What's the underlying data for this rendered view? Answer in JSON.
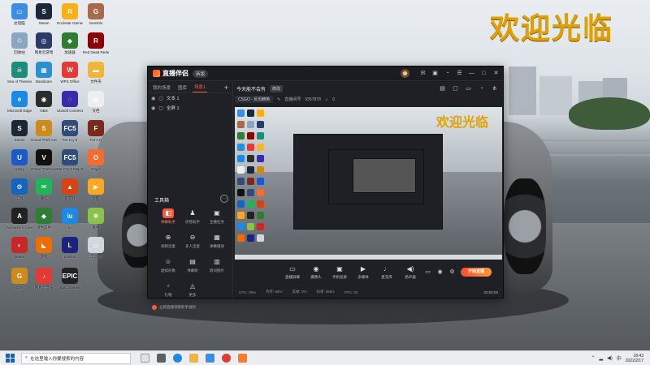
{
  "desktop": {
    "welcome_text": "欢迎光临",
    "icons": [
      {
        "label": "此电脑",
        "color": "#3a8ee6",
        "glyph": "▭"
      },
      {
        "label": "Steam",
        "color": "#1b2838",
        "glyph": "S"
      },
      {
        "label": "Rockstar Games...",
        "color": "#fcaf17",
        "glyph": "R"
      },
      {
        "label": "Genshin",
        "color": "#a86a4a",
        "glyph": "G"
      },
      {
        "label": "回收站",
        "color": "#8aa6c1",
        "glyph": "♲"
      },
      {
        "label": "网易云游戏",
        "color": "#2a3b6a",
        "glyph": "◎"
      },
      {
        "label": "加速器",
        "color": "#2e7d32",
        "glyph": "◆"
      },
      {
        "label": "Red Dead Redemption",
        "color": "#8b0000",
        "glyph": "R"
      },
      {
        "label": "Sea of Thieves",
        "color": "#1e8c7a",
        "glyph": "☠"
      },
      {
        "label": "Bandicam",
        "color": "#2b8fd0",
        "glyph": "▦"
      },
      {
        "label": "WPS Office",
        "color": "#e53935",
        "glyph": "W"
      },
      {
        "label": "文件夹",
        "color": "#f2b53c",
        "glyph": "▬"
      },
      {
        "label": "Microsoft Edge",
        "color": "#1a8ae2",
        "glyph": "e"
      },
      {
        "label": "OBS",
        "color": "#2c2c2c",
        "glyph": "◉"
      },
      {
        "label": "Ubisoft Connect",
        "color": "#3b2ba8",
        "glyph": "◌"
      },
      {
        "label": "文档",
        "color": "#eeeeee",
        "glyph": "▤"
      },
      {
        "label": "Steam",
        "color": "#1b2838",
        "glyph": "S"
      },
      {
        "label": "Grand Theft Auto V",
        "color": "#ce8a1d",
        "glyph": "5"
      },
      {
        "label": "Far Cry 5",
        "color": "#314b7a",
        "glyph": "FC5"
      },
      {
        "label": "Far Cry",
        "color": "#7a2a1a",
        "glyph": "F"
      },
      {
        "label": "Uplay",
        "color": "#1a5ac9",
        "glyph": "U"
      },
      {
        "label": "Grand Theft Auto V",
        "color": "#111111",
        "glyph": "V"
      },
      {
        "label": "Far Cry 5 Map Editor",
        "color": "#314b7a",
        "glyph": "FC5"
      },
      {
        "label": "Origin",
        "color": "#f56c2d",
        "glyph": "O"
      },
      {
        "label": "工具",
        "color": "#1565c0",
        "glyph": "⚙"
      },
      {
        "label": "微信",
        "color": "#20b45a",
        "glyph": "✉"
      },
      {
        "label": "新游戏",
        "color": "#d84315",
        "glyph": "▲"
      },
      {
        "label": "优酷",
        "color": "#f9a825",
        "glyph": "▶"
      },
      {
        "label": "Assassin's Creed",
        "color": "#222222",
        "glyph": "A"
      },
      {
        "label": "绿色软件",
        "color": "#2e7d32",
        "glyph": "◆"
      },
      {
        "label": "iu",
        "color": "#1e88e5",
        "glyph": "iu"
      },
      {
        "label": "素材",
        "color": "#8bc34a",
        "glyph": "❋"
      },
      {
        "label": "steam",
        "color": "#c62828",
        "glyph": "◐"
      },
      {
        "label": "游戏",
        "color": "#ef6c00",
        "glyph": "◣"
      },
      {
        "label": "Lumion",
        "color": "#1a237e",
        "glyph": "L"
      },
      {
        "label": "工具箱",
        "color": "#cfd8dc",
        "glyph": "▭"
      },
      {
        "label": "GTA",
        "color": "#ce8a1d",
        "glyph": "G"
      },
      {
        "label": "网易云音乐",
        "color": "#e53935",
        "glyph": "♪"
      },
      {
        "label": "Epic Games",
        "color": "#222222",
        "glyph": "EPIC"
      }
    ]
  },
  "window": {
    "app_name": "直播伴侣",
    "edition": "新版",
    "left_tabs": [
      "我的场景",
      "图库",
      "场景1"
    ],
    "sources": [
      "文本 1",
      "全屏 1"
    ],
    "toolbox_title": "工具箱",
    "toolbox_more": "···",
    "tools": [
      {
        "label": "弹幕助手",
        "glyph": "◧",
        "hot": true
      },
      {
        "label": "房管助手",
        "glyph": "♟",
        "hot": false
      },
      {
        "label": "主播任务",
        "glyph": "▣",
        "hot": false
      },
      {
        "label": "视频连麦",
        "glyph": "⊕",
        "hot": false
      },
      {
        "label": "多人连麦",
        "glyph": "⊖",
        "hot": false
      },
      {
        "label": "弹幕播放",
        "glyph": "▦",
        "hot": false
      },
      {
        "label": "虚拟形象",
        "glyph": "☺",
        "hot": false
      },
      {
        "label": "弹幕姬",
        "glyph": "▤",
        "hot": false
      },
      {
        "label": "歌词图片",
        "glyph": "▥",
        "hot": false
      },
      {
        "label": "礼物",
        "glyph": "▫",
        "hot": false
      },
      {
        "label": "更多",
        "glyph": "◬",
        "hot": false
      }
    ],
    "ad_text": "立即直播领取新手福利",
    "stream_title": "今天能不会有",
    "edit_button": "修改",
    "game_select": "CSGO - 反恐精英",
    "room_label": "直播间号",
    "room_id": "9357878",
    "preview_welcome": "欢迎光临",
    "bottom_items": [
      {
        "label": "直播屏幕",
        "glyph": "▭"
      },
      {
        "label": "摄像头",
        "glyph": "◉"
      },
      {
        "label": "手机投屏",
        "glyph": "▣"
      },
      {
        "label": "多媒体",
        "glyph": "▶"
      },
      {
        "label": "麦克风",
        "glyph": "♩"
      },
      {
        "label": "扬声器",
        "glyph": "◀)"
      }
    ],
    "go_live": "开始直播",
    "status": [
      "CPU: 26%",
      "内存: 68%",
      "丢帧: 0%",
      "码率: 0kb/s",
      "FPS: 30"
    ],
    "status_time": "00:00:00"
  },
  "taskbar": {
    "search_placeholder": "在这里输入你要搜索的内容",
    "time": "18:43",
    "date": "2022/2/17"
  }
}
